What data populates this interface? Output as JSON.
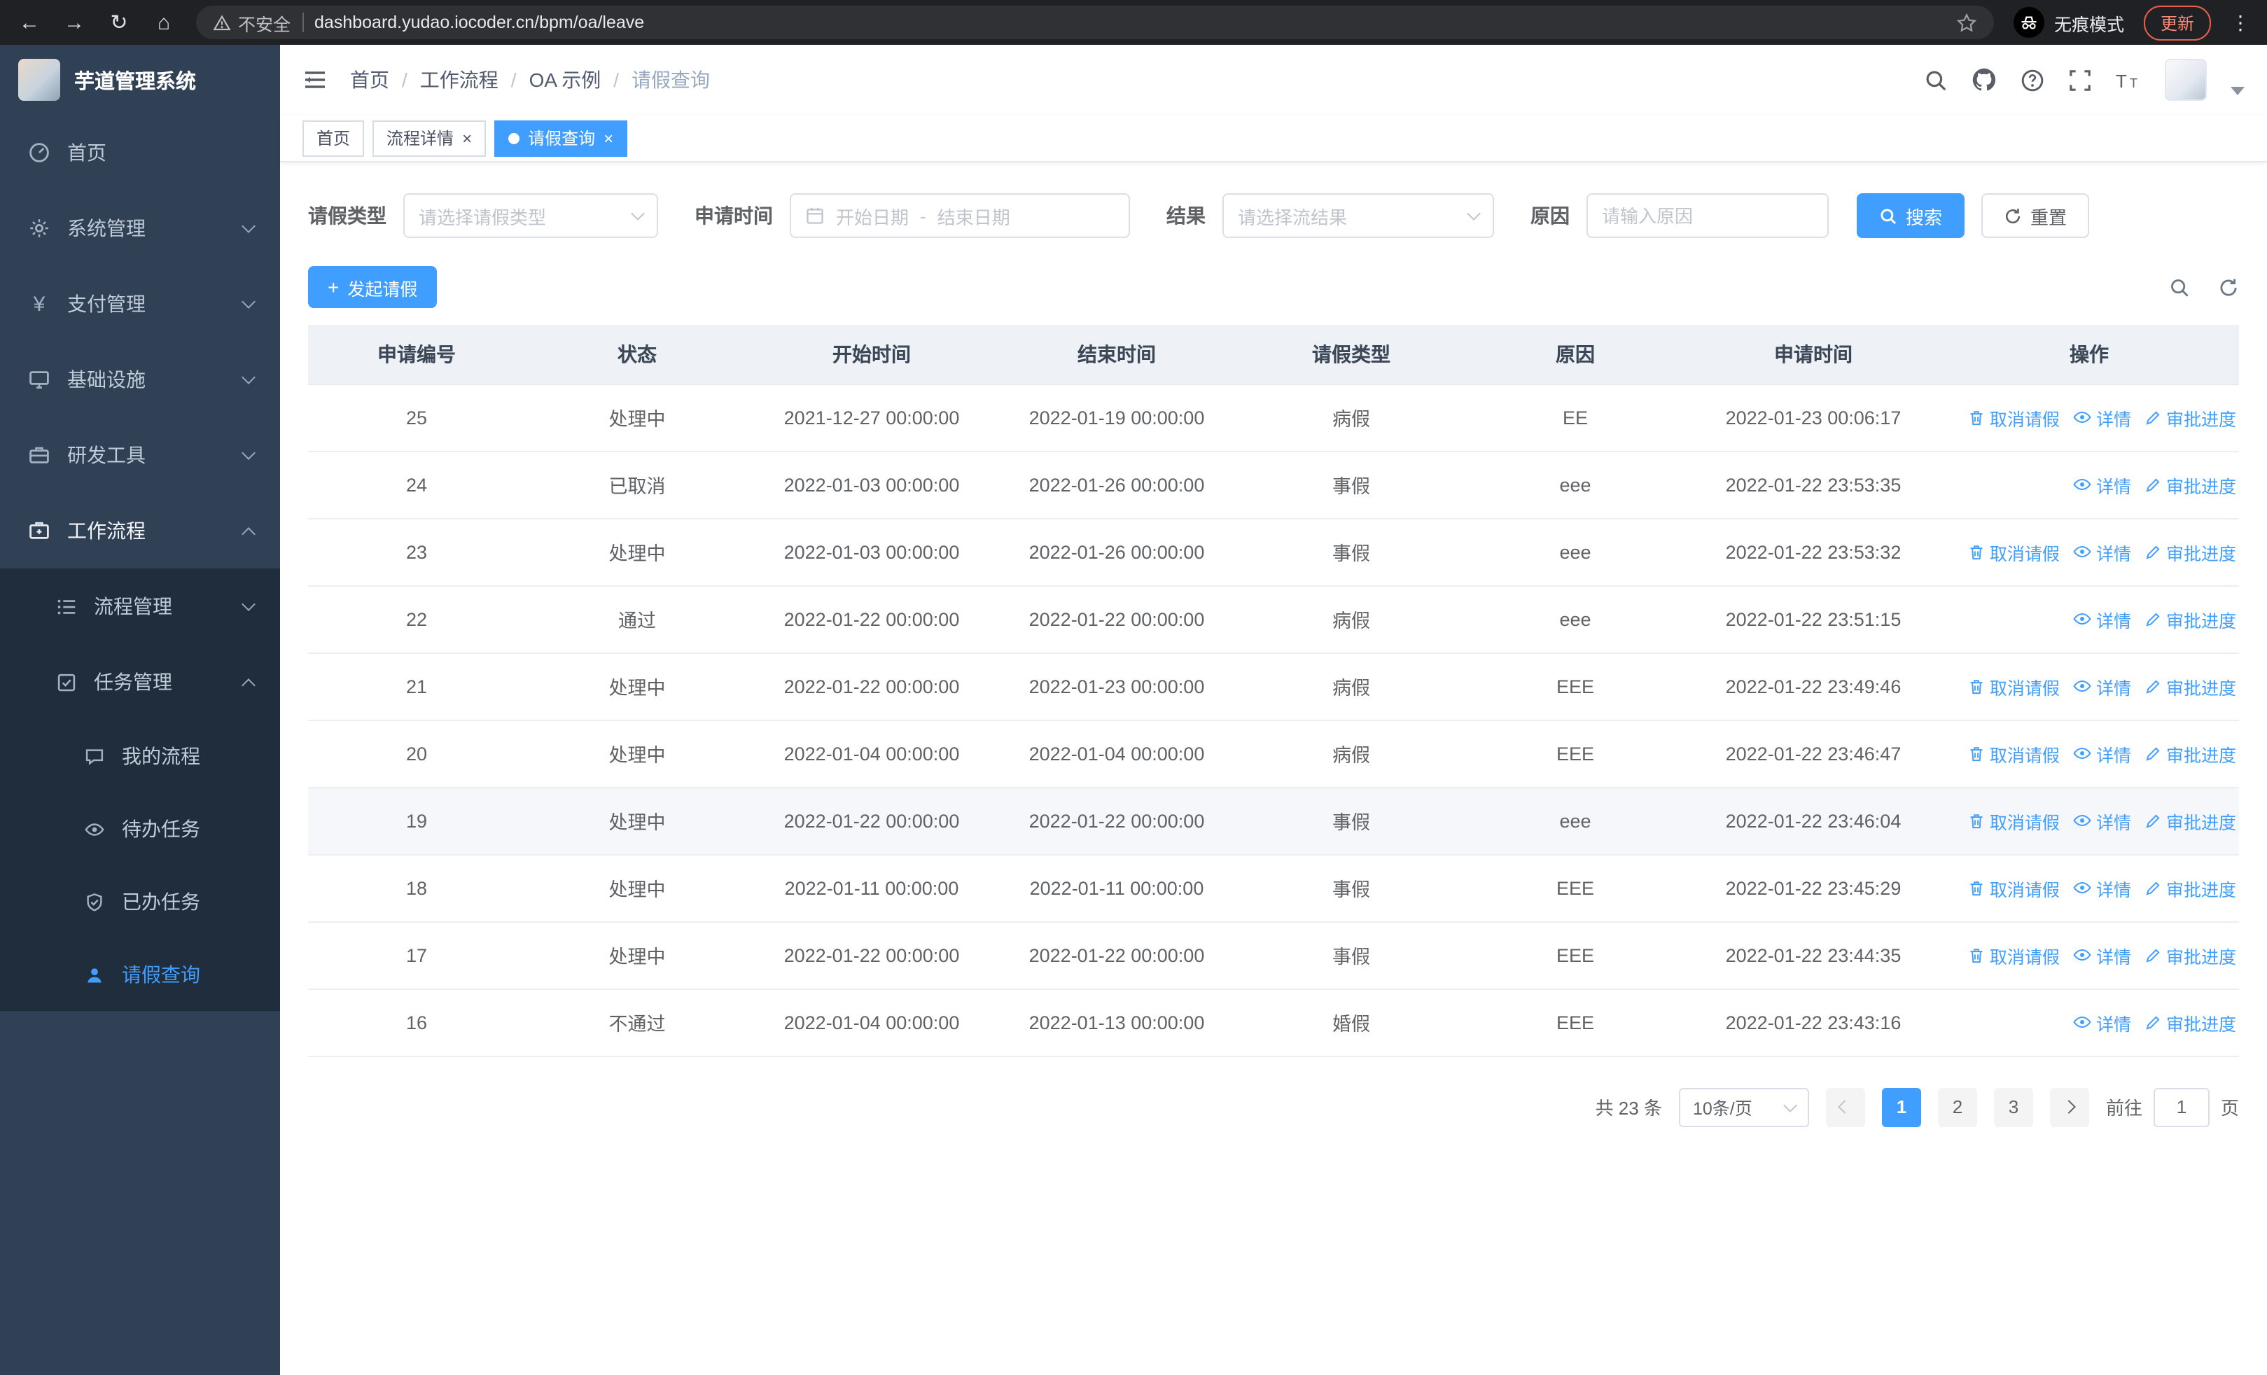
{
  "browser": {
    "security_label": "不安全",
    "url": "dashboard.yudao.iocoder.cn/bpm/oa/leave",
    "incognito_label": "无痕模式",
    "update_label": "更新"
  },
  "app": {
    "logo_title": "芋道管理系统"
  },
  "sidebar": {
    "items": [
      {
        "label": "首页"
      },
      {
        "label": "系统管理"
      },
      {
        "label": "支付管理"
      },
      {
        "label": "基础设施"
      },
      {
        "label": "研发工具"
      },
      {
        "label": "工作流程"
      }
    ],
    "workflow_children": {
      "process_label": "流程管理",
      "task_label": "任务管理",
      "task_children": [
        {
          "label": "我的流程"
        },
        {
          "label": "待办任务"
        },
        {
          "label": "已办任务"
        },
        {
          "label": "请假查询"
        }
      ]
    }
  },
  "breadcrumb": {
    "items": [
      "首页",
      "工作流程",
      "OA 示例",
      "请假查询"
    ]
  },
  "tabs": [
    {
      "label": "首页"
    },
    {
      "label": "流程详情"
    },
    {
      "label": "请假查询"
    }
  ],
  "filters": {
    "leave_type_label": "请假类型",
    "leave_type_placeholder": "请选择请假类型",
    "apply_time_label": "申请时间",
    "start_date_placeholder": "开始日期",
    "date_separator": "-",
    "end_date_placeholder": "结束日期",
    "result_label": "结果",
    "result_placeholder": "请选择流结果",
    "reason_label": "原因",
    "reason_placeholder": "请输入原因",
    "search_label": "搜索",
    "reset_label": "重置"
  },
  "toolbar": {
    "create_label": "发起请假"
  },
  "table": {
    "columns": [
      "申请编号",
      "状态",
      "开始时间",
      "结束时间",
      "请假类型",
      "原因",
      "申请时间",
      "操作"
    ],
    "op_labels": {
      "cancel": "取消请假",
      "detail": "详情",
      "progress": "审批进度"
    },
    "rows": [
      {
        "id": "25",
        "status": "处理中",
        "start": "2021-12-27 00:00:00",
        "end": "2022-01-19 00:00:00",
        "type": "病假",
        "reason": "EE",
        "applied": "2022-01-23 00:06:17",
        "ops": [
          "cancel",
          "detail",
          "progress"
        ],
        "hover": false
      },
      {
        "id": "24",
        "status": "已取消",
        "start": "2022-01-03 00:00:00",
        "end": "2022-01-26 00:00:00",
        "type": "事假",
        "reason": "eee",
        "applied": "2022-01-22 23:53:35",
        "ops": [
          "detail",
          "progress"
        ],
        "hover": false
      },
      {
        "id": "23",
        "status": "处理中",
        "start": "2022-01-03 00:00:00",
        "end": "2022-01-26 00:00:00",
        "type": "事假",
        "reason": "eee",
        "applied": "2022-01-22 23:53:32",
        "ops": [
          "cancel",
          "detail",
          "progress"
        ],
        "hover": false
      },
      {
        "id": "22",
        "status": "通过",
        "start": "2022-01-22 00:00:00",
        "end": "2022-01-22 00:00:00",
        "type": "病假",
        "reason": "eee",
        "applied": "2022-01-22 23:51:15",
        "ops": [
          "detail",
          "progress"
        ],
        "hover": false
      },
      {
        "id": "21",
        "status": "处理中",
        "start": "2022-01-22 00:00:00",
        "end": "2022-01-23 00:00:00",
        "type": "病假",
        "reason": "EEE",
        "applied": "2022-01-22 23:49:46",
        "ops": [
          "cancel",
          "detail",
          "progress"
        ],
        "hover": false
      },
      {
        "id": "20",
        "status": "处理中",
        "start": "2022-01-04 00:00:00",
        "end": "2022-01-04 00:00:00",
        "type": "病假",
        "reason": "EEE",
        "applied": "2022-01-22 23:46:47",
        "ops": [
          "cancel",
          "detail",
          "progress"
        ],
        "hover": false
      },
      {
        "id": "19",
        "status": "处理中",
        "start": "2022-01-22 00:00:00",
        "end": "2022-01-22 00:00:00",
        "type": "事假",
        "reason": "eee",
        "applied": "2022-01-22 23:46:04",
        "ops": [
          "cancel",
          "detail",
          "progress"
        ],
        "hover": true
      },
      {
        "id": "18",
        "status": "处理中",
        "start": "2022-01-11 00:00:00",
        "end": "2022-01-11 00:00:00",
        "type": "事假",
        "reason": "EEE",
        "applied": "2022-01-22 23:45:29",
        "ops": [
          "cancel",
          "detail",
          "progress"
        ],
        "hover": false
      },
      {
        "id": "17",
        "status": "处理中",
        "start": "2022-01-22 00:00:00",
        "end": "2022-01-22 00:00:00",
        "type": "事假",
        "reason": "EEE",
        "applied": "2022-01-22 23:44:35",
        "ops": [
          "cancel",
          "detail",
          "progress"
        ],
        "hover": false
      },
      {
        "id": "16",
        "status": "不通过",
        "start": "2022-01-04 00:00:00",
        "end": "2022-01-13 00:00:00",
        "type": "婚假",
        "reason": "EEE",
        "applied": "2022-01-22 23:43:16",
        "ops": [
          "detail",
          "progress"
        ],
        "hover": false
      }
    ]
  },
  "pagination": {
    "total_label": "共 23 条",
    "page_size": "10条/页",
    "pages": [
      "1",
      "2",
      "3"
    ],
    "current": "1",
    "goto_label": "前往",
    "goto_value": "1",
    "page_unit": "页"
  },
  "colors": {
    "primary": "#409eff",
    "sidebar_bg": "#304156",
    "sidebar_sub_bg": "#1f2d3d",
    "update_red": "#e8604c"
  },
  "icons": {
    "back-icon": "←",
    "forward-icon": "→",
    "reload-icon": "↻",
    "home-icon": "⌂",
    "warning-icon": "⚠",
    "star-icon": "☆",
    "kebab-menu-icon": "⋮",
    "close-icon": "×",
    "plus-icon": "+"
  }
}
